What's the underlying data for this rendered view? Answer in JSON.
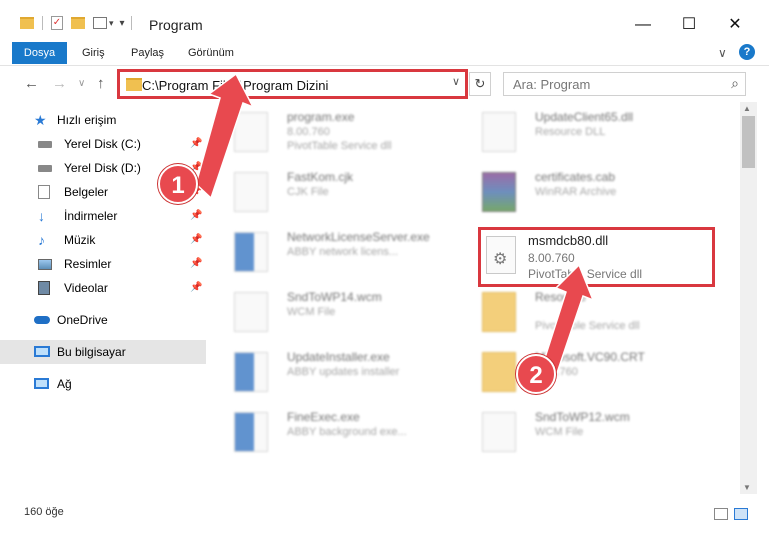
{
  "window": {
    "title": "Program",
    "minimize": "—",
    "maximize": "☐",
    "close": "✕"
  },
  "ribbon": {
    "tabs": [
      "Dosya",
      "Giriş",
      "Paylaş",
      "Görünüm"
    ],
    "expand": "∨",
    "help": "?"
  },
  "nav": {
    "address": "C:\\Program Files\\Program Dizini",
    "search_placeholder": "Ara: Program",
    "back": "←",
    "forward": "→",
    "up": "↑",
    "recent": "∨",
    "dropdown": "∨",
    "refresh": "↻",
    "search_icon": "⌕"
  },
  "sidebar": {
    "items": [
      {
        "label": "Hızlı erişim",
        "icon": "star-icon"
      },
      {
        "label": "Yerel Disk (C:)",
        "icon": "drive-icon"
      },
      {
        "label": "Yerel Disk (D:)",
        "icon": "drive-icon"
      },
      {
        "label": "Belgeler",
        "icon": "documents-icon"
      },
      {
        "label": "İndirmeler",
        "icon": "download-icon"
      },
      {
        "label": "Müzik",
        "icon": "music-icon"
      },
      {
        "label": "Resimler",
        "icon": "pictures-icon"
      },
      {
        "label": "Videolar",
        "icon": "videos-icon"
      },
      {
        "label": "OneDrive",
        "icon": "cloud-icon"
      },
      {
        "label": "Bu bilgisayar",
        "icon": "computer-icon"
      },
      {
        "label": "Ağ",
        "icon": "network-icon"
      }
    ]
  },
  "files": [
    {
      "name": "program.exe",
      "line2": "8.00.760",
      "line3": "PivotTable Service dll"
    },
    {
      "name": "UpdateClient65.dll",
      "line2": "Resource DLL",
      "line3": ""
    },
    {
      "name": "FastKom.cjk",
      "line2": "CJK File",
      "line3": ""
    },
    {
      "name": "certificates.cab",
      "line2": "WinRAR Archive",
      "line3": ""
    },
    {
      "name": "NetworkLicenseServer.exe",
      "line2": "ABBY network licens...",
      "line3": ""
    },
    {
      "name": "SndToWP14.wcm",
      "line2": "WCM File",
      "line3": ""
    },
    {
      "name": "Resource",
      "line2": "",
      "line3": "PivotTable Service dll"
    },
    {
      "name": "UpdateInstaller.exe",
      "line2": "ABBY updates installer",
      "line3": ""
    },
    {
      "name": "Microsoft.VC90.CRT",
      "line2": "8.00.760",
      "line3": ""
    },
    {
      "name": "FineExec.exe",
      "line2": "ABBY background exe...",
      "line3": ""
    },
    {
      "name": "SndToWP12.wcm",
      "line2": "WCM File",
      "line3": ""
    }
  ],
  "highlighted_file": {
    "name": "msmdcb80.dll",
    "version": "8.00.760",
    "description": "PivotTable Service dll"
  },
  "annotations": {
    "step1": "1",
    "step2": "2",
    "color": "#e8494f"
  },
  "status": {
    "count": "160 öğe"
  }
}
